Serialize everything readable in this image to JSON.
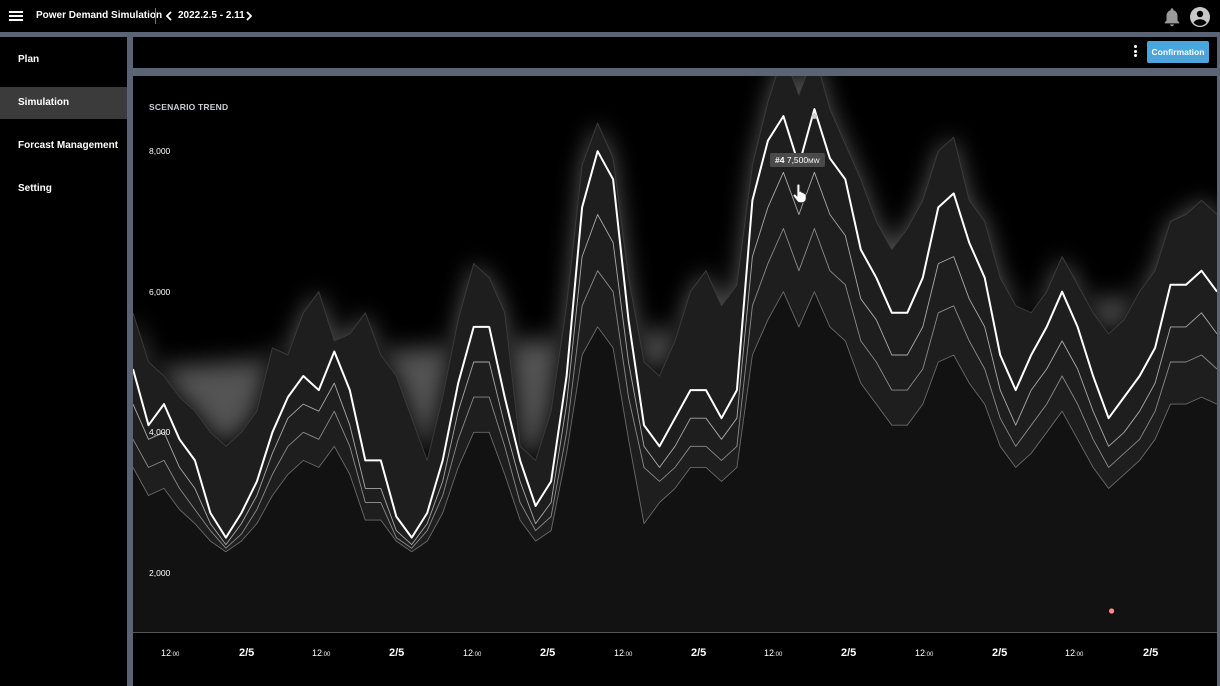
{
  "header": {
    "app_title": "Power Demand Simulation",
    "date_range": "2022.2.5 - 2.11",
    "icons": [
      "menu-icon",
      "chevron-left-icon",
      "chevron-right-icon",
      "bell-icon",
      "account-icon"
    ]
  },
  "sidebar": {
    "items": [
      {
        "label": "Plan",
        "active": false
      },
      {
        "label": "Simulation",
        "active": true
      },
      {
        "label": "Forcast Management",
        "active": false
      },
      {
        "label": "Setting",
        "active": false
      }
    ]
  },
  "toolbar": {
    "confirm_label": "Confirmation",
    "confirm_color": "#4aa6dd"
  },
  "chart": {
    "title": "SCENARIO TREND",
    "tooltip_id": "#4",
    "tooltip_value": "7,500",
    "tooltip_unit": "MW"
  },
  "chart_data": {
    "type": "line",
    "title": "SCENARIO TREND",
    "ylim": [
      0,
      8500
    ],
    "y_ticks": [
      "2,000",
      "4,000",
      "6,000",
      "8,000"
    ],
    "x_ticks": [
      {
        "hour": "12",
        "min": ":00"
      },
      {
        "date": "2/5"
      },
      {
        "hour": "12",
        "min": ":00"
      },
      {
        "date": "2/5"
      },
      {
        "hour": "12",
        "min": ":00"
      },
      {
        "date": "2/5"
      },
      {
        "hour": "12",
        "min": ":00"
      },
      {
        "date": "2/5"
      },
      {
        "hour": "12",
        "min": ":00"
      },
      {
        "date": "2/5"
      },
      {
        "hour": "12",
        "min": ":00"
      },
      {
        "date": "2/5"
      },
      {
        "hour": "12",
        "min": ":00"
      },
      {
        "date": "2/5"
      }
    ],
    "series_main": [
      3900,
      3100,
      3400,
      2900,
      2600,
      1850,
      1500,
      1850,
      2300,
      3000,
      3500,
      3800,
      3600,
      4150,
      3600,
      2600,
      2600,
      1800,
      1500,
      1850,
      2600,
      3700,
      4500,
      4500,
      3500,
      2600,
      1950,
      2300,
      3800,
      6200,
      7000,
      6600,
      4600,
      3100,
      2800,
      3200,
      3600,
      3600,
      3200,
      3600,
      6300,
      7150,
      7500,
      6800,
      7600,
      6900,
      6600,
      5600,
      5200,
      4700,
      4700,
      5200,
      6200,
      6400,
      5700,
      5200,
      4100,
      3600,
      4100,
      4500,
      5000,
      4500,
      3800,
      3200,
      3500,
      3800,
      4200,
      5100,
      5100,
      5300,
      5000
    ],
    "series_upper": [
      4700,
      4000,
      3800,
      3500,
      3300,
      3000,
      2800,
      3000,
      3300,
      4200,
      4100,
      4700,
      5000,
      4300,
      4400,
      4700,
      4100,
      3800,
      3200,
      2600,
      3500,
      4600,
      5400,
      5200,
      4700,
      2800,
      2600,
      3300,
      4800,
      6800,
      7400,
      6900,
      5200,
      4000,
      3800,
      4300,
      5000,
      5300,
      4800,
      5100,
      6800,
      7700,
      8400,
      7800,
      8400,
      7600,
      7100,
      6600,
      6000,
      5600,
      5900,
      6300,
      7000,
      7200,
      6300,
      6000,
      5200,
      4800,
      4700,
      5000,
      5500,
      5100,
      4700,
      4400,
      4600,
      5000,
      5300,
      6000,
      6100,
      6300,
      6100
    ],
    "series_lower": [
      3400,
      2900,
      3000,
      2500,
      2200,
      1700,
      1400,
      1700,
      2100,
      2700,
      3200,
      3400,
      3300,
      3700,
      3100,
      2200,
      2200,
      1600,
      1400,
      1700,
      2300,
      3300,
      4000,
      4000,
      3100,
      2300,
      1700,
      2000,
      3400,
      5500,
      6100,
      5700,
      4000,
      2800,
      2500,
      2800,
      3200,
      3200,
      2900,
      3200,
      5500,
      6200,
      6700,
      6100,
      6700,
      6100,
      5800,
      4900,
      4600,
      4100,
      4100,
      4500,
      5400,
      5500,
      4900,
      4500,
      3600,
      3100,
      3600,
      3900,
      4300,
      3900,
      3300,
      2800,
      3000,
      3300,
      3700,
      4500,
      4500,
      4700,
      4400
    ],
    "series_lower2": [
      2900,
      2500,
      2600,
      2200,
      1900,
      1600,
      1350,
      1550,
      1900,
      2400,
      2800,
      3000,
      2900,
      3300,
      2800,
      2000,
      2000,
      1500,
      1350,
      1600,
      2100,
      2900,
      3500,
      3500,
      2800,
      2000,
      1600,
      1800,
      3000,
      4800,
      5300,
      5000,
      3500,
      2500,
      2300,
      2500,
      2800,
      2800,
      2600,
      2800,
      4800,
      5400,
      5900,
      5300,
      5900,
      5300,
      5100,
      4300,
      4000,
      3600,
      3600,
      3900,
      4700,
      4800,
      4300,
      3900,
      3200,
      2800,
      3100,
      3400,
      3800,
      3400,
      2900,
      2500,
      2700,
      2900,
      3300,
      4000,
      4000,
      4100,
      3900
    ],
    "series_lower3": [
      2500,
      2100,
      2200,
      1900,
      1700,
      1450,
      1300,
      1450,
      1700,
      2100,
      2400,
      2600,
      2500,
      2800,
      2400,
      1750,
      1750,
      1450,
      1300,
      1450,
      1850,
      2500,
      3000,
      3000,
      2400,
      1750,
      1450,
      1600,
      2700,
      4100,
      4500,
      4200,
      2900,
      1700,
      2000,
      2200,
      2500,
      2500,
      2300,
      2500,
      4100,
      4600,
      5000,
      4500,
      5000,
      4500,
      4300,
      3700,
      3400,
      3100,
      3100,
      3400,
      4000,
      4100,
      3700,
      3400,
      2800,
      2500,
      2700,
      3000,
      3300,
      2900,
      2500,
      2200,
      2400,
      2600,
      2900,
      3400,
      3400,
      3500,
      3400
    ],
    "highlight": {
      "index": 44,
      "value": 7500
    },
    "low_marker": {
      "index": 30,
      "value": 1400
    }
  }
}
